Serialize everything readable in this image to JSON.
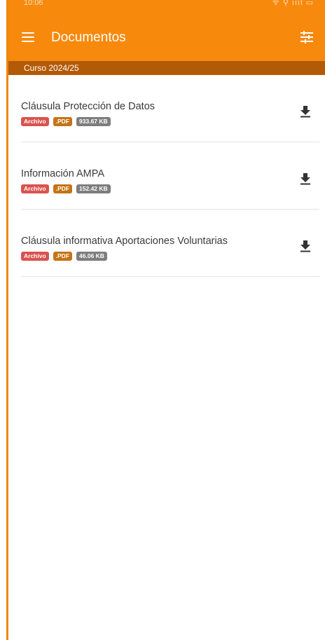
{
  "status_bar": {
    "time": "10:06",
    "signal": "ᯤ ⚲ ıııl ▭"
  },
  "header": {
    "title": "Documentos"
  },
  "course": {
    "label": "Curso 2024/25"
  },
  "documents": [
    {
      "title": "Cláusula Protección de Datos",
      "type_tag": "Archivo",
      "format_tag": ".PDF",
      "size_tag": "933.67 KB"
    },
    {
      "title": "Información AMPA",
      "type_tag": "Archivo",
      "format_tag": ".PDF",
      "size_tag": "152.42 KB"
    },
    {
      "title": "Cláusula informativa Aportaciones Voluntarias",
      "type_tag": "Archivo",
      "format_tag": ".PDF",
      "size_tag": "46.06 KB"
    }
  ],
  "colors": {
    "primary": "#f7890c",
    "course_bar": "#b35a06",
    "archivo_tag": "#d9534f",
    "pdf_tag": "#c57316",
    "size_tag": "#7d7d7d"
  },
  "icons": {
    "menu": "menu-icon",
    "filter": "filter-sliders-icon",
    "download": "download-icon"
  }
}
